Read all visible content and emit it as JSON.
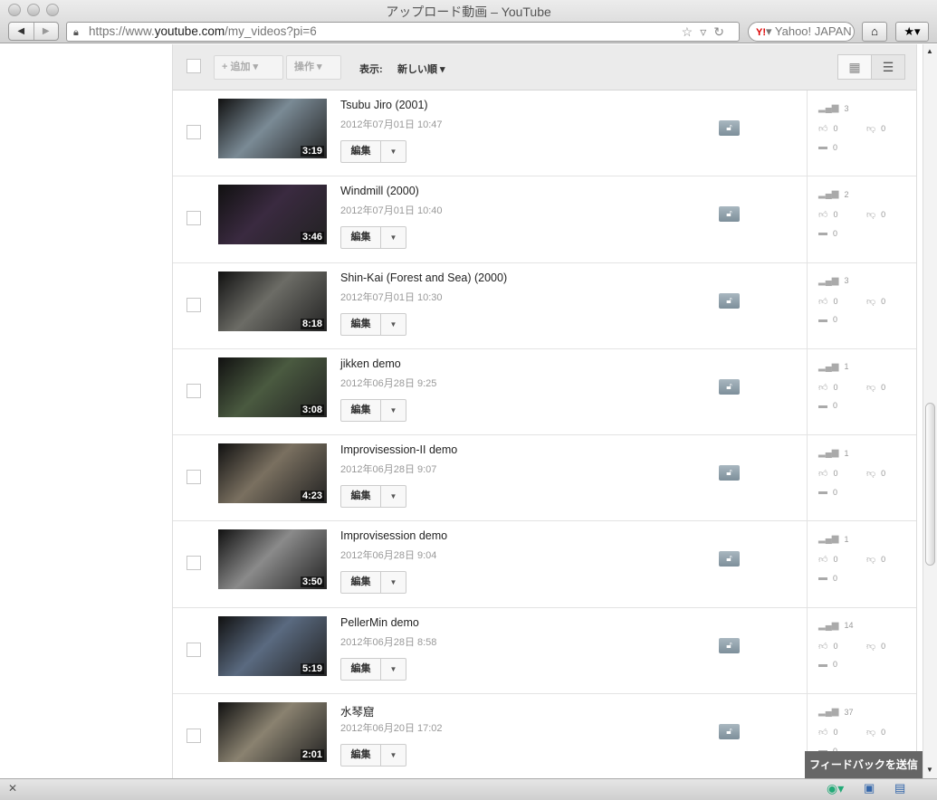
{
  "window": {
    "title": "アップロード動画 – YouTube"
  },
  "browser": {
    "url_prefix": "https://www.",
    "url_domain": "youtube.com",
    "url_path": "/my_videos?pi=6",
    "search_placeholder": "Yahoo! JAPAN",
    "yahoo_logo": "Y!"
  },
  "toolbar": {
    "add_label": "+ 追加",
    "actions_label": "操作",
    "view_label": "表示:",
    "sort_label": "新しい順"
  },
  "videos": [
    {
      "title": "Tsubu Jiro (2001)",
      "date": "2012年07月01日 10:47",
      "duration": "3:19",
      "views": "3",
      "likes": "0",
      "dislikes": "0",
      "comments": "0",
      "edit": "編集",
      "thumb": "#7a8a95"
    },
    {
      "title": "Windmill (2000)",
      "date": "2012年07月01日 10:40",
      "duration": "3:46",
      "views": "2",
      "likes": "0",
      "dislikes": "0",
      "comments": "0",
      "edit": "編集",
      "thumb": "#3a2a40"
    },
    {
      "title": "Shin-Kai (Forest and Sea) (2000)",
      "date": "2012年07月01日 10:30",
      "duration": "8:18",
      "views": "3",
      "likes": "0",
      "dislikes": "0",
      "comments": "0",
      "edit": "編集",
      "thumb": "#6c6c66"
    },
    {
      "title": "jikken demo",
      "date": "2012年06月28日 9:25",
      "duration": "3:08",
      "views": "1",
      "likes": "0",
      "dislikes": "0",
      "comments": "0",
      "edit": "編集",
      "thumb": "#4a5a40"
    },
    {
      "title": "Improvisession-II demo",
      "date": "2012年06月28日 9:07",
      "duration": "4:23",
      "views": "1",
      "likes": "0",
      "dislikes": "0",
      "comments": "0",
      "edit": "編集",
      "thumb": "#7a7060"
    },
    {
      "title": "Improvisession demo",
      "date": "2012年06月28日 9:04",
      "duration": "3:50",
      "views": "1",
      "likes": "0",
      "dislikes": "0",
      "comments": "0",
      "edit": "編集",
      "thumb": "#8a8a8a"
    },
    {
      "title": "PellerMin demo",
      "date": "2012年06月28日 8:58",
      "duration": "5:19",
      "views": "14",
      "likes": "0",
      "dislikes": "0",
      "comments": "0",
      "edit": "編集",
      "thumb": "#5a6a80"
    },
    {
      "title": "水琴窟",
      "date": "2012年06月20日 17:02",
      "duration": "2:01",
      "views": "37",
      "likes": "0",
      "dislikes": "0",
      "comments": "0",
      "edit": "編集",
      "thumb": "#8a8270"
    }
  ],
  "feedback": {
    "label": "フィードバックを送信"
  }
}
